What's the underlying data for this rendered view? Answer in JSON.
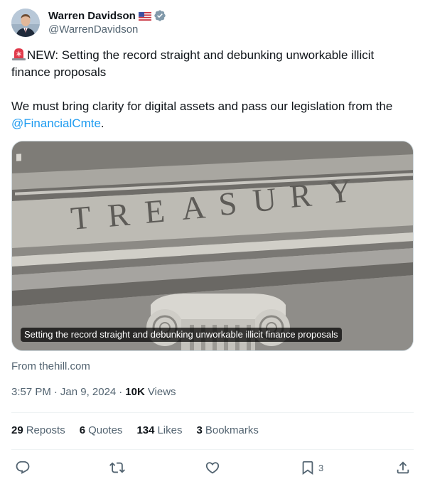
{
  "author": {
    "display_name": "Warren Davidson",
    "handle": "@WarrenDavidson",
    "flag_icon": "us-flag-icon",
    "verified_icon": "verified-badge-icon"
  },
  "tweet": {
    "line1_text": "NEW: Setting the record straight and debunking unworkable illicit finance proposals",
    "line2_text": "We must bring clarity for digital assets and pass our legislation from the ",
    "mention": "@FinancialCmte",
    "line2_end": "."
  },
  "card": {
    "caption": "Setting the record straight and debunking unworkable illicit finance proposals",
    "source": "From thehill.com"
  },
  "meta": {
    "time": "3:57 PM",
    "separator": "·",
    "date": "Jan 9, 2024",
    "views_count": "10K",
    "views_label": "Views"
  },
  "stats": {
    "reposts_count": "29",
    "reposts_label": "Reposts",
    "quotes_count": "6",
    "quotes_label": "Quotes",
    "likes_count": "134",
    "likes_label": "Likes",
    "bookmarks_count": "3",
    "bookmarks_label": "Bookmarks"
  },
  "actions": {
    "bookmark_count": "3"
  },
  "colors": {
    "text": "#0f1419",
    "secondary": "#536471",
    "link": "#1d9bf0",
    "divider": "#eff3f4",
    "verified": "#829aab"
  }
}
